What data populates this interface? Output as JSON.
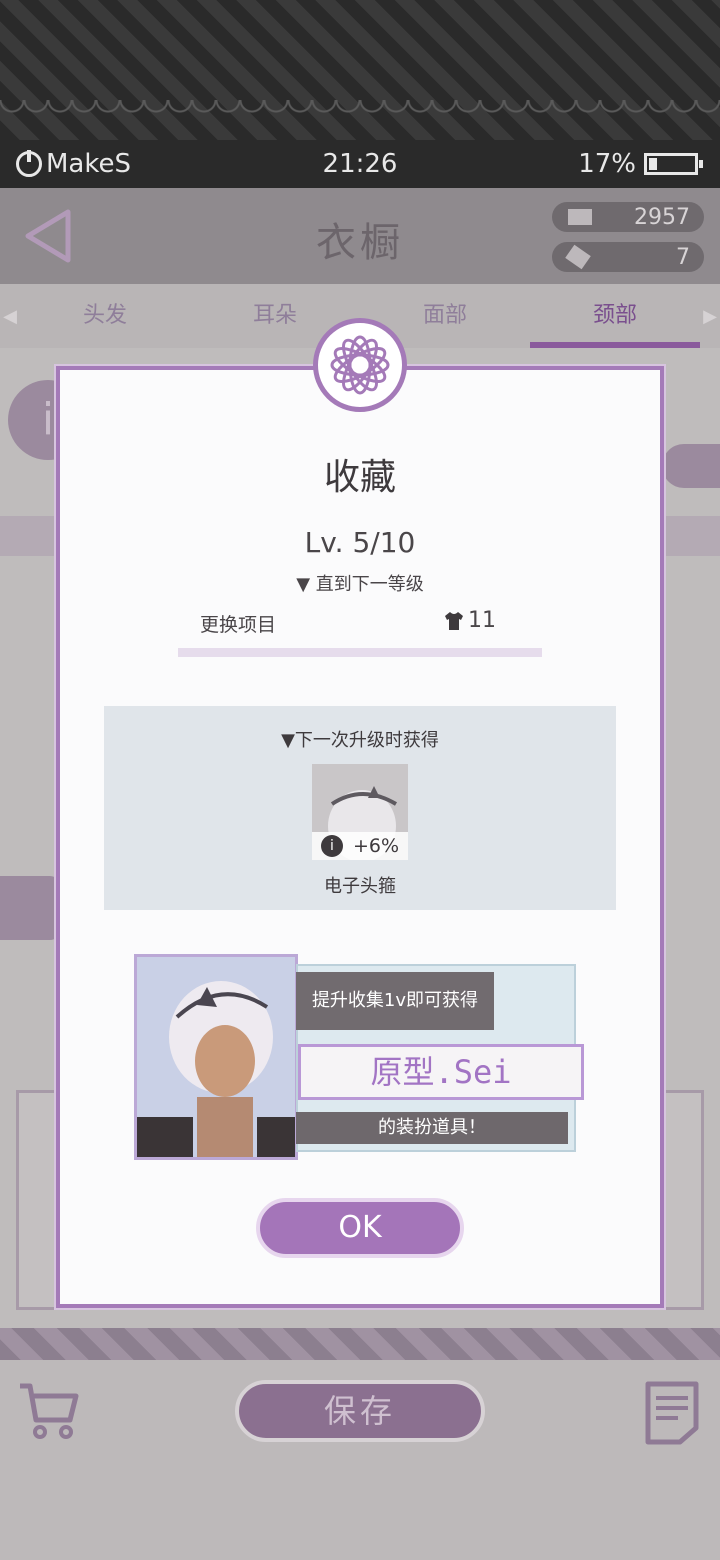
{
  "statusbar": {
    "brand": "MakeS",
    "time": "21:26",
    "battery": "17%",
    "battery_level": 0.17
  },
  "header": {
    "title": "衣橱",
    "currency_1": "2957",
    "currency_2": "7"
  },
  "tabs": [
    {
      "label": "头发",
      "active": false
    },
    {
      "label": "耳朵",
      "active": false
    },
    {
      "label": "面部",
      "active": false
    },
    {
      "label": "颈部",
      "active": true
    }
  ],
  "bottom": {
    "save_label": "保存"
  },
  "dialog": {
    "title": "收藏",
    "level": "Lv. 5/10",
    "next_level": "▼ 直到下一等级",
    "need_label": "更换项目",
    "need_count": "11",
    "progress": 0.0,
    "reward_heading": "▼下一次升级时获得",
    "reward_bonus": "+6%",
    "reward_name": "电子头箍",
    "unlock_line1": "提升收集1v即可获得",
    "unlock_name": "原型.Sei",
    "unlock_line3": "的装扮道具！",
    "ok_label": "OK"
  },
  "colors": {
    "accent": "#a475b9",
    "dialog_border": "#a47ab8"
  }
}
